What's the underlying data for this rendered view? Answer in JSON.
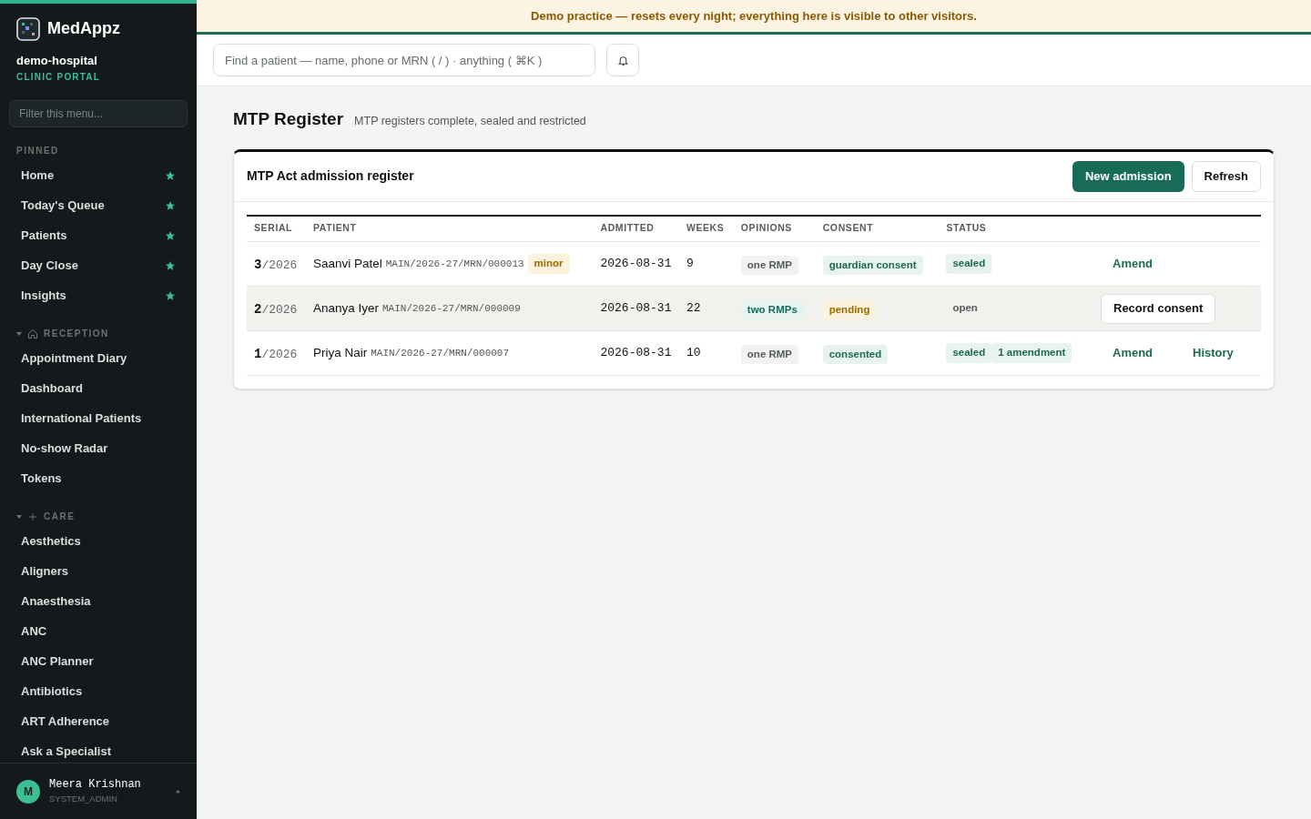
{
  "banner": "Demo practice — resets every night; everything here is visible to other visitors.",
  "sidebar": {
    "brand": "MedAppz",
    "tenant": "demo-hospital",
    "portal": "CLINIC PORTAL",
    "filter_placeholder": "Filter this menu...",
    "pinned_label": "PINNED",
    "pinned": [
      {
        "label": "Home",
        "starred": true
      },
      {
        "label": "Today's Queue",
        "starred": true
      },
      {
        "label": "Patients",
        "starred": true
      },
      {
        "label": "Day Close",
        "starred": true
      },
      {
        "label": "Insights",
        "starred": true
      }
    ],
    "sections": [
      {
        "title": "RECEPTION",
        "kind": "home",
        "expanded": true,
        "items": [
          "Appointment Diary",
          "Dashboard",
          "International Patients",
          "No-show Radar",
          "Tokens"
        ]
      },
      {
        "title": "CARE",
        "kind": "plus",
        "expanded": true,
        "items": [
          "Aesthetics",
          "Aligners",
          "Anaesthesia",
          "ANC",
          "ANC Planner",
          "Antibiotics",
          "ART Adherence",
          "Ask a Specialist"
        ]
      }
    ],
    "user": {
      "initial": "M",
      "name": "Meera Krishnan",
      "role": "SYSTEM_ADMIN"
    }
  },
  "search": {
    "placeholder": "Find a patient — name, phone or MRN ( / ) · anything ( ⌘K )"
  },
  "page": {
    "title": "MTP Register",
    "subtitle": "MTP registers complete, sealed and restricted"
  },
  "card": {
    "title": "MTP Act admission register",
    "buttons": [
      {
        "label": "New admission",
        "kind": "primary"
      },
      {
        "label": "Refresh",
        "kind": "secondary"
      }
    ]
  },
  "table": {
    "columns": [
      "SERIAL",
      "PATIENT",
      "ADMITTED",
      "WEEKS",
      "OPINIONS",
      "CONSENT",
      "STATUS"
    ],
    "rows": [
      {
        "serial": "3",
        "year": "/2026",
        "name": "Saanvi Patel",
        "mrn": "MAIN/2026-27/MRN/000013",
        "flag": {
          "text": "minor",
          "kind": "warning"
        },
        "admitted": "2026-08-31",
        "weeks": "9",
        "selected": false,
        "opinions": {
          "text": "one RMP",
          "kind": "neutral"
        },
        "consent": {
          "text": "guardian consent",
          "kind": "success"
        },
        "status": [
          {
            "text": "sealed",
            "kind": "success"
          }
        ],
        "actions": [
          {
            "label": "Amend",
            "kind": "link"
          }
        ]
      },
      {
        "serial": "2",
        "year": "/2026",
        "name": "Ananya Iyer",
        "mrn": "MAIN/2026-27/MRN/000009",
        "admitted": "2026-08-31",
        "weeks": "22",
        "selected": true,
        "opinions": {
          "text": "two RMPs",
          "kind": "info"
        },
        "consent": {
          "text": "pending",
          "kind": "warning"
        },
        "status": [
          {
            "text": "open",
            "kind": "plain"
          }
        ],
        "actions": [
          {
            "label": "Record consent",
            "kind": "button"
          }
        ]
      },
      {
        "serial": "1",
        "year": "/2026",
        "name": "Priya Nair",
        "mrn": "MAIN/2026-27/MRN/000007",
        "admitted": "2026-08-31",
        "weeks": "10",
        "selected": false,
        "opinions": {
          "text": "one RMP",
          "kind": "neutral"
        },
        "consent": {
          "text": "consented",
          "kind": "success"
        },
        "status": [
          {
            "text": "sealed",
            "kind": "success"
          },
          {
            "text": "1 amendment",
            "kind": "success"
          }
        ],
        "actions": [
          {
            "label": "Amend",
            "kind": "link"
          },
          {
            "label": "History",
            "kind": "link"
          }
        ]
      }
    ]
  }
}
